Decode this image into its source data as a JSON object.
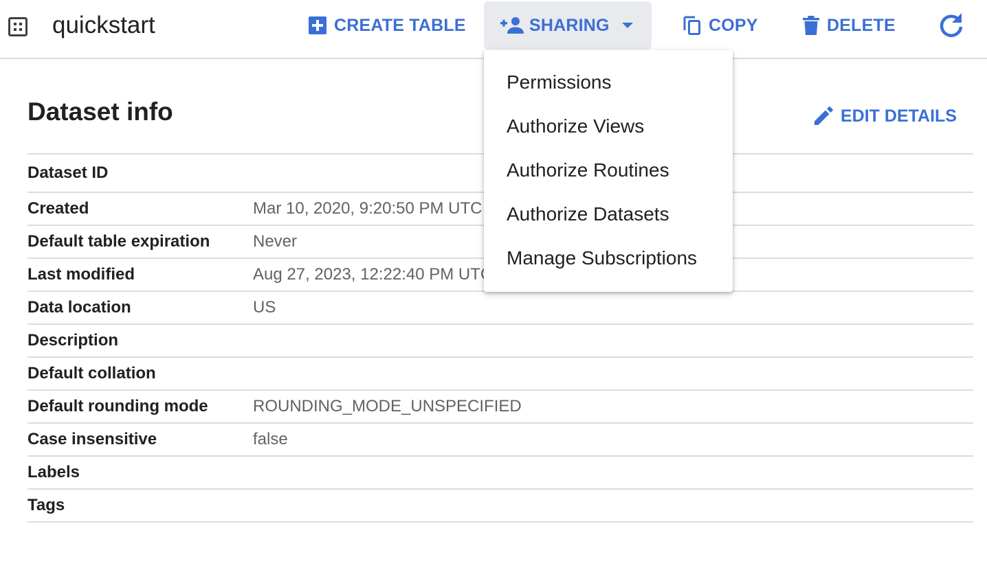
{
  "toolbar": {
    "dataset_name": "quickstart",
    "create_table_label": "CREATE TABLE",
    "sharing_label": "SHARING",
    "copy_label": "COPY",
    "delete_label": "DELETE",
    "refresh_icon": "refresh-icon",
    "accent_color": "#3b6fd6"
  },
  "main": {
    "title": "Dataset info",
    "edit_details_label": "EDIT DETAILS",
    "rows": [
      {
        "label": "Dataset ID",
        "value": ""
      },
      {
        "label": "Created",
        "value": "Mar 10, 2020, 9:20:50 PM UTC"
      },
      {
        "label": "Default table expiration",
        "value": "Never"
      },
      {
        "label": "Last modified",
        "value": "Aug 27, 2023, 12:22:40 PM UTC"
      },
      {
        "label": "Data location",
        "value": "US"
      },
      {
        "label": "Description",
        "value": ""
      },
      {
        "label": "Default collation",
        "value": ""
      },
      {
        "label": "Default rounding mode",
        "value": "ROUNDING_MODE_UNSPECIFIED"
      },
      {
        "label": "Case insensitive",
        "value": "false"
      },
      {
        "label": "Labels",
        "value": ""
      },
      {
        "label": "Tags",
        "value": ""
      }
    ]
  },
  "sharing_menu": {
    "items": [
      "Permissions",
      "Authorize Views",
      "Authorize Routines",
      "Authorize Datasets",
      "Manage Subscriptions"
    ]
  }
}
